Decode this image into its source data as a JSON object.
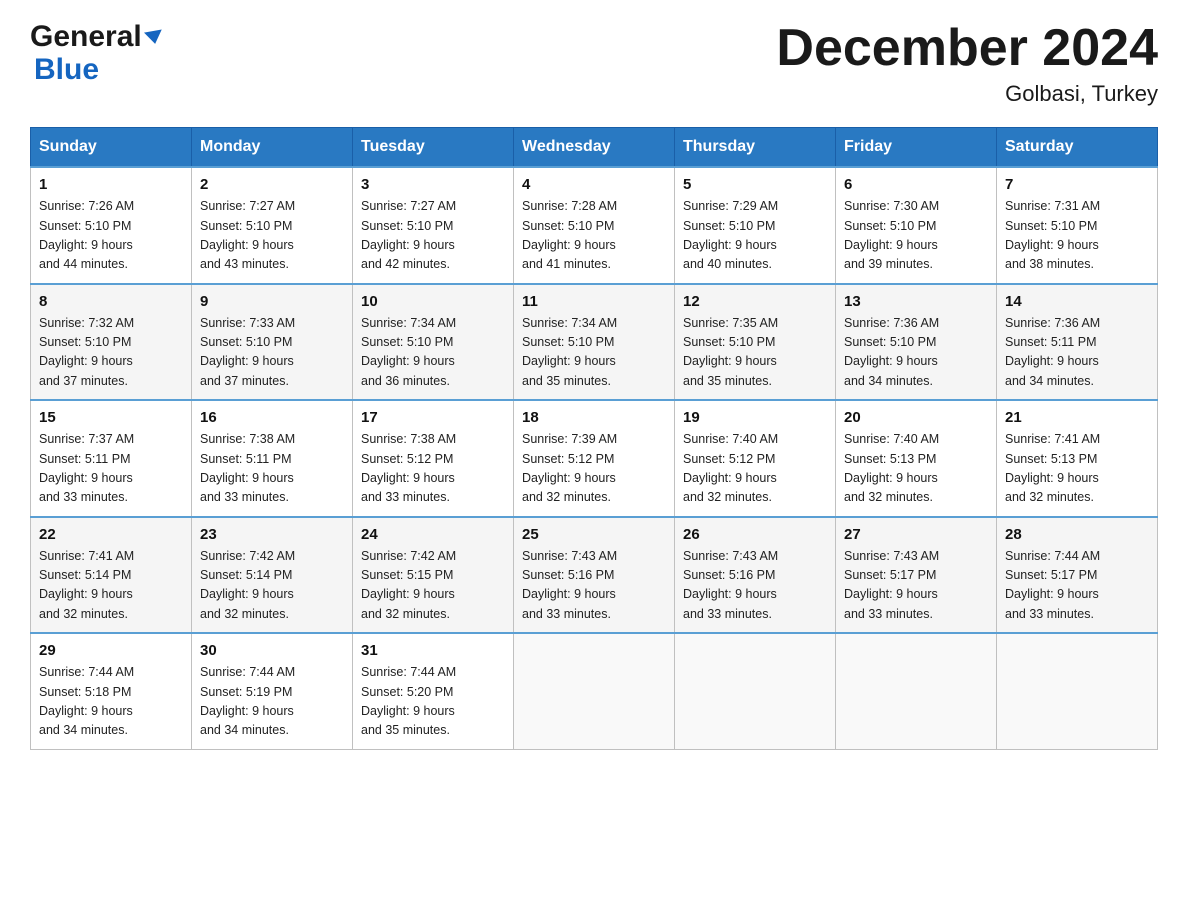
{
  "logo": {
    "general": "General",
    "blue": "Blue"
  },
  "title": "December 2024",
  "location": "Golbasi, Turkey",
  "days_of_week": [
    "Sunday",
    "Monday",
    "Tuesday",
    "Wednesday",
    "Thursday",
    "Friday",
    "Saturday"
  ],
  "weeks": [
    [
      {
        "day": "1",
        "sunrise": "7:26 AM",
        "sunset": "5:10 PM",
        "daylight": "9 hours and 44 minutes."
      },
      {
        "day": "2",
        "sunrise": "7:27 AM",
        "sunset": "5:10 PM",
        "daylight": "9 hours and 43 minutes."
      },
      {
        "day": "3",
        "sunrise": "7:27 AM",
        "sunset": "5:10 PM",
        "daylight": "9 hours and 42 minutes."
      },
      {
        "day": "4",
        "sunrise": "7:28 AM",
        "sunset": "5:10 PM",
        "daylight": "9 hours and 41 minutes."
      },
      {
        "day": "5",
        "sunrise": "7:29 AM",
        "sunset": "5:10 PM",
        "daylight": "9 hours and 40 minutes."
      },
      {
        "day": "6",
        "sunrise": "7:30 AM",
        "sunset": "5:10 PM",
        "daylight": "9 hours and 39 minutes."
      },
      {
        "day": "7",
        "sunrise": "7:31 AM",
        "sunset": "5:10 PM",
        "daylight": "9 hours and 38 minutes."
      }
    ],
    [
      {
        "day": "8",
        "sunrise": "7:32 AM",
        "sunset": "5:10 PM",
        "daylight": "9 hours and 37 minutes."
      },
      {
        "day": "9",
        "sunrise": "7:33 AM",
        "sunset": "5:10 PM",
        "daylight": "9 hours and 37 minutes."
      },
      {
        "day": "10",
        "sunrise": "7:34 AM",
        "sunset": "5:10 PM",
        "daylight": "9 hours and 36 minutes."
      },
      {
        "day": "11",
        "sunrise": "7:34 AM",
        "sunset": "5:10 PM",
        "daylight": "9 hours and 35 minutes."
      },
      {
        "day": "12",
        "sunrise": "7:35 AM",
        "sunset": "5:10 PM",
        "daylight": "9 hours and 35 minutes."
      },
      {
        "day": "13",
        "sunrise": "7:36 AM",
        "sunset": "5:10 PM",
        "daylight": "9 hours and 34 minutes."
      },
      {
        "day": "14",
        "sunrise": "7:36 AM",
        "sunset": "5:11 PM",
        "daylight": "9 hours and 34 minutes."
      }
    ],
    [
      {
        "day": "15",
        "sunrise": "7:37 AM",
        "sunset": "5:11 PM",
        "daylight": "9 hours and 33 minutes."
      },
      {
        "day": "16",
        "sunrise": "7:38 AM",
        "sunset": "5:11 PM",
        "daylight": "9 hours and 33 minutes."
      },
      {
        "day": "17",
        "sunrise": "7:38 AM",
        "sunset": "5:12 PM",
        "daylight": "9 hours and 33 minutes."
      },
      {
        "day": "18",
        "sunrise": "7:39 AM",
        "sunset": "5:12 PM",
        "daylight": "9 hours and 32 minutes."
      },
      {
        "day": "19",
        "sunrise": "7:40 AM",
        "sunset": "5:12 PM",
        "daylight": "9 hours and 32 minutes."
      },
      {
        "day": "20",
        "sunrise": "7:40 AM",
        "sunset": "5:13 PM",
        "daylight": "9 hours and 32 minutes."
      },
      {
        "day": "21",
        "sunrise": "7:41 AM",
        "sunset": "5:13 PM",
        "daylight": "9 hours and 32 minutes."
      }
    ],
    [
      {
        "day": "22",
        "sunrise": "7:41 AM",
        "sunset": "5:14 PM",
        "daylight": "9 hours and 32 minutes."
      },
      {
        "day": "23",
        "sunrise": "7:42 AM",
        "sunset": "5:14 PM",
        "daylight": "9 hours and 32 minutes."
      },
      {
        "day": "24",
        "sunrise": "7:42 AM",
        "sunset": "5:15 PM",
        "daylight": "9 hours and 32 minutes."
      },
      {
        "day": "25",
        "sunrise": "7:43 AM",
        "sunset": "5:16 PM",
        "daylight": "9 hours and 33 minutes."
      },
      {
        "day": "26",
        "sunrise": "7:43 AM",
        "sunset": "5:16 PM",
        "daylight": "9 hours and 33 minutes."
      },
      {
        "day": "27",
        "sunrise": "7:43 AM",
        "sunset": "5:17 PM",
        "daylight": "9 hours and 33 minutes."
      },
      {
        "day": "28",
        "sunrise": "7:44 AM",
        "sunset": "5:17 PM",
        "daylight": "9 hours and 33 minutes."
      }
    ],
    [
      {
        "day": "29",
        "sunrise": "7:44 AM",
        "sunset": "5:18 PM",
        "daylight": "9 hours and 34 minutes."
      },
      {
        "day": "30",
        "sunrise": "7:44 AM",
        "sunset": "5:19 PM",
        "daylight": "9 hours and 34 minutes."
      },
      {
        "day": "31",
        "sunrise": "7:44 AM",
        "sunset": "5:20 PM",
        "daylight": "9 hours and 35 minutes."
      },
      null,
      null,
      null,
      null
    ]
  ]
}
